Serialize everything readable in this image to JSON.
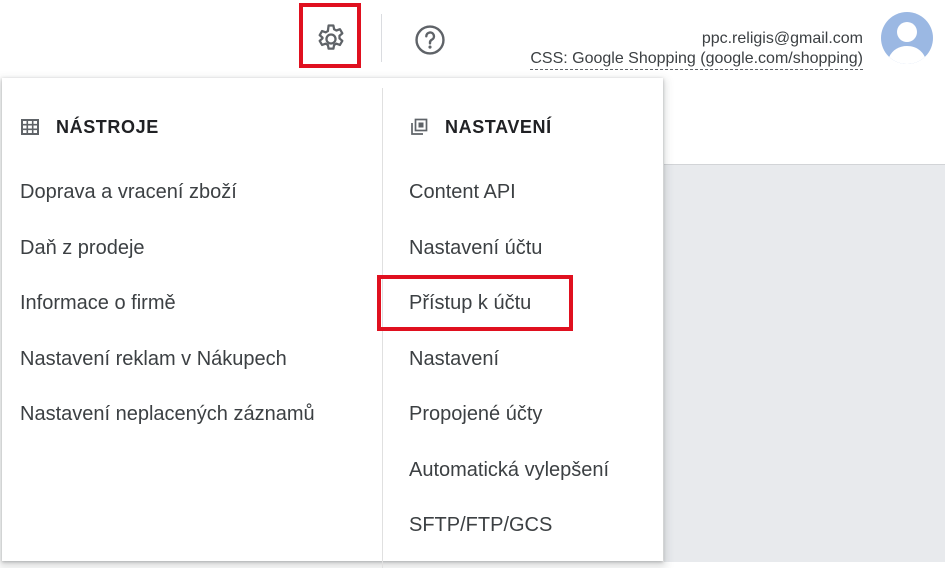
{
  "header": {
    "settings_icon": "gear-icon",
    "help_icon": "help-circle-icon",
    "account_email": "ppc.religis@gmail.com",
    "account_subtitle": "CSS: Google Shopping (google.com/shopping)",
    "avatar_icon": "avatar-person-icon"
  },
  "menu": {
    "tools": {
      "icon": "grid-table-icon",
      "title": "NÁSTROJE",
      "items": [
        {
          "label": "Doprava a vracení zboží"
        },
        {
          "label": "Daň z prodeje"
        },
        {
          "label": "Informace o firmě"
        },
        {
          "label": "Nastavení reklam v Nákupech"
        },
        {
          "label": "Nastavení neplacených záznamů"
        }
      ]
    },
    "settings": {
      "icon": "copy-layers-icon",
      "title": "NASTAVENÍ",
      "items": [
        {
          "label": "Content API"
        },
        {
          "label": "Nastavení účtu"
        },
        {
          "label": "Přístup k účtu"
        },
        {
          "label": "Nastavení"
        },
        {
          "label": "Propojené účty"
        },
        {
          "label": "Automatická vylepšení"
        },
        {
          "label": "SFTP/FTP/GCS"
        }
      ]
    }
  },
  "colors": {
    "highlight": "#e0101f",
    "text": "#3c4043",
    "icon": "#5f6368"
  }
}
